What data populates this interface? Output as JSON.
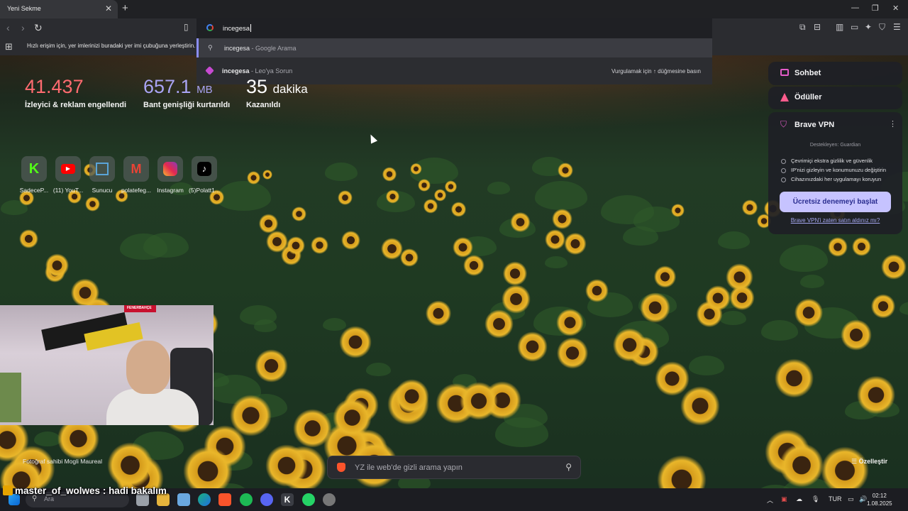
{
  "browser": {
    "tab_title": "Yeni Sekme",
    "address_value": "incegesa",
    "bookmarks_hint": "Hızlı erişim için, yer imlerinizi buradaki yer imi çubuğuna yerleştirin."
  },
  "suggestions": [
    {
      "query": "incegesa",
      "source": " - Google Arama",
      "icon": "search-icon"
    },
    {
      "query": "incegesa",
      "source": " - Leo'ya Sorun",
      "icon": "leo-icon",
      "hint": "Vurgulamak için ↑ düğmesine basın"
    }
  ],
  "stats": [
    {
      "value": "41.437",
      "unit": "",
      "label": "İzleyici & reklam engellendi",
      "color": "#ff6b70"
    },
    {
      "value": "657.1",
      "unit": "MB",
      "label": "Bant genişliği kurtarıldı",
      "color": "#a9a4f5"
    },
    {
      "value": "35",
      "unit": "dakika",
      "label": "Kazanıldı",
      "color": "#ffffff"
    }
  ],
  "shortcuts": [
    {
      "label": "SadeceP...",
      "icon": "kick-icon"
    },
    {
      "label": "(11) YouT...",
      "icon": "youtube-icon"
    },
    {
      "label": "Sunucu",
      "icon": "server-icon"
    },
    {
      "label": "polatefeg...",
      "icon": "gmail-icon"
    },
    {
      "label": "Instagram",
      "icon": "instagram-icon"
    },
    {
      "label": "(5)Polatt1...",
      "icon": "tiktok-icon"
    }
  ],
  "widgets": {
    "chat": "Sohbet",
    "rewards": "Ödüller",
    "vpn": {
      "title": "Brave VPN",
      "supported_by": "Destekleyen:",
      "partner": "Guardian",
      "features": [
        "Çevrimiçi ekstra gizlilik ve güvenlik",
        "IP'nizi gizleyin ve konumunuzu değiştirin",
        "Cihazınızdaki her uygulamayı koruyun"
      ],
      "cta": "Ücretsiz denemeyi başlat",
      "link": "Brave VPN'i zaten satın aldınız mı?"
    }
  },
  "photo_credit": "Fotoğraf sahibi Mogli Maureal",
  "customize": "Özelleştir",
  "search_placeholder": "YZ ile web'de gizli arama yapın",
  "stream_chat": {
    "user": "master_of_wolwes",
    "sep": " : ",
    "message": "hadi bakalım"
  },
  "webcam_banner": "FENERBAHÇE",
  "taskbar": {
    "search_placeholder": "Ara",
    "language": "TUR",
    "time": "02:12",
    "date": "1.08.2025"
  }
}
